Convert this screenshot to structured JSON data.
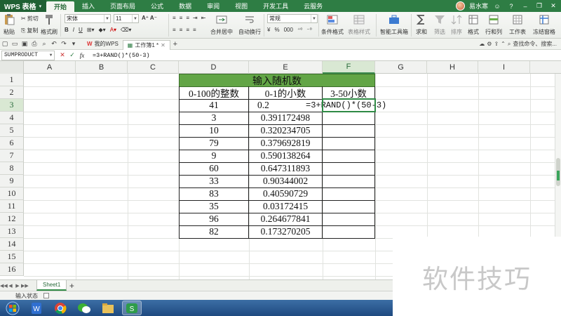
{
  "app": {
    "name": "WPS 表格",
    "user": "易水寒"
  },
  "menu": [
    "开始",
    "插入",
    "页面布局",
    "公式",
    "数据",
    "审阅",
    "视图",
    "开发工具",
    "云服务"
  ],
  "ribbon": {
    "cut": "剪切",
    "paste": "粘贴",
    "copy": "复制",
    "format_painter": "格式刷",
    "font_name": "宋体",
    "font_size": "11",
    "merge_center": "合并居中",
    "wrap_text": "自动换行",
    "number_format": "常规",
    "conditional_format": "条件格式",
    "table_style": "表格样式",
    "smart_toolbox": "智能工具箱",
    "sum": "求和",
    "filter": "筛选",
    "sort": "排序",
    "format": "格式",
    "rows_cols": "行和列",
    "worksheet": "工作表",
    "freeze": "冻结窗格",
    "currency": "¥",
    "percent": "%"
  },
  "quick_access": {
    "my_wps": "我的WPS",
    "doc_tab": "工作簿1 *",
    "search": "查找命令、搜索..."
  },
  "formula_bar": {
    "name_box": "SUMPRODUCT",
    "cancel": "✕",
    "confirm": "✓",
    "fx": "fx",
    "formula": "=3+RAND()*(50-3)"
  },
  "columns": [
    "A",
    "B",
    "C",
    "D",
    "E",
    "F",
    "G",
    "H",
    "I"
  ],
  "rows": [
    "1",
    "2",
    "3",
    "4",
    "5",
    "6",
    "7",
    "8",
    "9",
    "10",
    "11",
    "12",
    "13",
    "14",
    "15",
    "16"
  ],
  "table": {
    "title": "输入随机数",
    "headers": [
      "0-100的整数",
      "0-1的小数",
      "3-50小数"
    ],
    "col_d": [
      "41",
      "3",
      "10",
      "79",
      "9",
      "60",
      "33",
      "83",
      "35",
      "96",
      "82"
    ],
    "col_e": [
      "0.2",
      "0.391172498",
      "0.320234705",
      "0.379692819",
      "0.590138264",
      "0.647311893",
      "0.90344002",
      "0.40590729",
      "0.03172415",
      "0.264677841",
      "0.173270205"
    ],
    "editing_cell_text": "=3+RAND()*(50-3)"
  },
  "sheets": {
    "active": "Sheet1",
    "add": "+"
  },
  "status": {
    "text": "输入状态"
  },
  "watermark": "软件技巧",
  "colors": {
    "accent": "#2e7d44",
    "title_fill": "#62a546",
    "active_border": "#2f8a45"
  }
}
